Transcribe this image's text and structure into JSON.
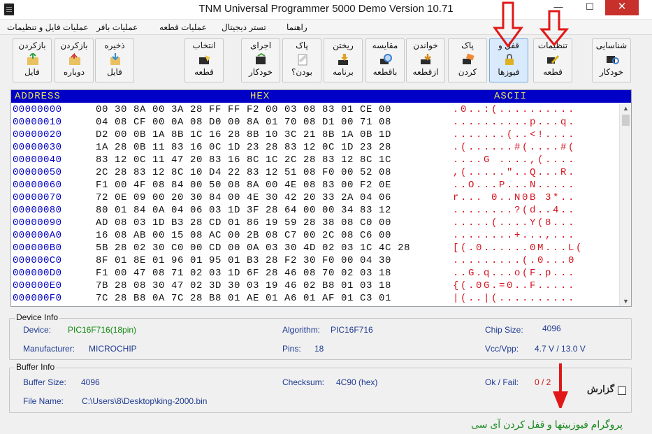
{
  "window": {
    "title": "TNM  Universal Programmer 5000 Demo    Version 10.71",
    "min_glyph": "—",
    "max_glyph": "☐",
    "close_glyph": "✕"
  },
  "menu": [
    "راهنما",
    "تستر دیجیتال",
    "عملیات قطعه",
    "عملیات بافر",
    "عملیات فایل و تنظیمات"
  ],
  "toolbar": [
    {
      "line1": "شناسایی",
      "line2": "خودکار",
      "icon": "chip-search-icon",
      "active": false
    },
    {
      "line1": "تنظیمات",
      "line2": "قطعه",
      "icon": "wrench-icon",
      "active": false
    },
    {
      "line1": "قفل و",
      "line2": "فیوزها",
      "icon": "lock-icon",
      "active": true
    },
    {
      "line1": "پاک",
      "line2": "کردن",
      "icon": "eraser-icon",
      "active": false
    },
    {
      "line1": "خواندن",
      "line2": "ازقطعه",
      "icon": "read-chip-icon",
      "active": false
    },
    {
      "line1": "مقایسه",
      "line2": "باقطعه",
      "icon": "compare-icon",
      "active": false
    },
    {
      "line1": "ریختن",
      "line2": "برنامه",
      "icon": "write-chip-icon",
      "active": false
    },
    {
      "line1": "پاک",
      "line2": "بودن؟",
      "icon": "blank-check-icon",
      "active": false
    },
    {
      "line1": "اجرای",
      "line2": "خودکار",
      "icon": "auto-run-icon",
      "active": false
    },
    {
      "line1": "انتخاب",
      "line2": "قطعه",
      "icon": "select-chip-icon",
      "active": false
    },
    {
      "line1": "ذخیره",
      "line2": "فایل",
      "icon": "save-icon",
      "active": false
    },
    {
      "line1": "بازکردن",
      "line2": "دوباره",
      "icon": "reopen-icon",
      "active": false
    },
    {
      "line1": "بازکردن",
      "line2": "فایل",
      "icon": "open-folder-icon",
      "active": false
    }
  ],
  "hex_view": {
    "headers": {
      "address": "ADDRESS",
      "hex": "HEX",
      "ascii": "ASCII"
    },
    "rows": [
      {
        "addr": "00000000",
        "hex": "00 30 8A 00 3A 28 FF FF F2 00 03 08 83 01 CE 00",
        "ascii": ".0..:(.........."
      },
      {
        "addr": "00000010",
        "hex": "04 08 CF 00 0A 08 D0 00 8A 01 70 08 D1 00 71 08",
        "ascii": "..........p...q."
      },
      {
        "addr": "00000020",
        "hex": "D2 00 0B 1A 8B 1C 16 28 8B 10 3C 21 8B 1A 0B 1D",
        "ascii": ".......(..<!...."
      },
      {
        "addr": "00000030",
        "hex": "1A 28 0B 11 83 16 0C 1D 23 28 83 12 0C 1D 23 28",
        "ascii": ".(......#(....#("
      },
      {
        "addr": "00000040",
        "hex": "83 12 0C 11 47 20 83 16 8C 1C 2C 28 83 12 8C 1C",
        "ascii": "....G ....,(...."
      },
      {
        "addr": "00000050",
        "hex": "2C 28 83 12 8C 10 D4 22 83 12 51 08 F0 00 52 08",
        "ascii": ",(.....\"..Q...R."
      },
      {
        "addr": "00000060",
        "hex": "F1 00 4F 08 84 00 50 08 8A 00 4E 08 83 00 F2 0E",
        "ascii": "..O...P...N....."
      },
      {
        "addr": "00000070",
        "hex": "72 0E 09 00 20 30 84 00 4E 30 42 20 33 2A 04 06",
        "ascii": "r... 0..N0B 3*.."
      },
      {
        "addr": "00000080",
        "hex": "80 01 84 0A 04 06 03 1D 3F 28 64 00 00 34 83 12",
        "ascii": "........?(d..4.."
      },
      {
        "addr": "00000090",
        "hex": "AD 08 03 1D B3 28 CD 01 86 19 59 28 38 08 C0 00",
        "ascii": ".....(....Y(8..."
      },
      {
        "addr": "000000A0",
        "hex": "16 08 AB 00 15 08 AC 00 2B 08 C7 00 2C 08 C6 00",
        "ascii": "........+...,..."
      },
      {
        "addr": "000000B0",
        "hex": "5B 28 02 30 C0 00 CD 00 0A 03 30 4D 02 03 1C 4C 28",
        "ascii": "[(.0......0M...L("
      },
      {
        "addr": "000000C0",
        "hex": "8F 01 8E 01 96 01 95 01 B3 28 F2 30 F0 00 04 30",
        "ascii": ".........(.0...0"
      },
      {
        "addr": "000000D0",
        "hex": "F1 00 47 08 71 02 03 1D 6F 28 46 08 70 02 03 18",
        "ascii": "..G.q...o(F.p..."
      },
      {
        "addr": "000000E0",
        "hex": "7B 28 08 30 47 02 3D 30 03 19 46 02 B8 01 03 18",
        "ascii": "{(.0G.=0..F....."
      },
      {
        "addr": "000000F0",
        "hex": "7C 28 B8 0A 7C 28 B8 01 AE 01 A6 01 AF 01 C3 01",
        "ascii": "|(..|(.........."
      }
    ]
  },
  "device_info": {
    "title": "Device Info",
    "device_label": "Device:",
    "device_value": "PIC16F716(18pin)",
    "algorithm_label": "Algorithm:",
    "algorithm_value": "PIC16F716",
    "chip_size_label": "Chip Size:",
    "chip_size_value": "4096",
    "manufacturer_label": "Manufacturer:",
    "manufacturer_value": "MICROCHIP",
    "pins_label": "Pins:",
    "pins_value": "18",
    "vcc_label": "Vcc/Vpp:",
    "vcc_value": "4.7 V / 13.0 V"
  },
  "buffer_info": {
    "title": "Buffer Info",
    "size_label": "Buffer Size:",
    "size_value": "4096",
    "checksum_label": "Checksum:",
    "checksum_value": "4C90 (hex)",
    "okfail_label": "Ok / Fail:",
    "okfail_value": "0 / 2",
    "filename_label": "File Name:",
    "filename_value": "C:\\Users\\8\\Desktop\\king-2000.bin"
  },
  "report": {
    "label": "گزارش",
    "checked": false
  },
  "caption": "پروگرام فیوزبیتها و قفل کردن آی سی",
  "colors": {
    "hex_header_bg": "#0000c6",
    "hex_header_text": "#e6e25a",
    "address_text": "#0000c8",
    "ascii_text": "#d4141e",
    "info_text": "#1f3b93",
    "device_value": "#138a13",
    "fail_value": "#d2141a",
    "caption": "#16881c",
    "annotation_arrow": "#e01818"
  }
}
